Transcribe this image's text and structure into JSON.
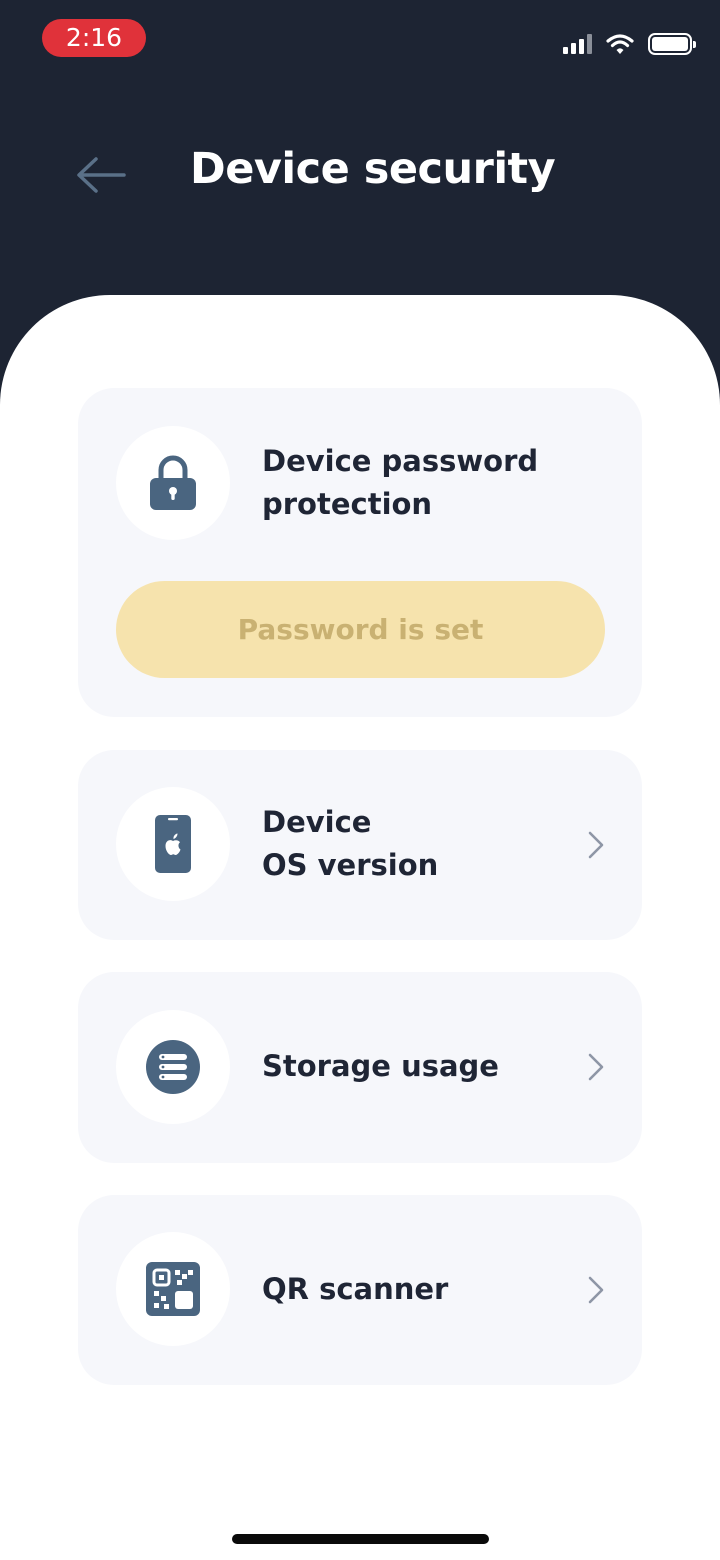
{
  "status_bar": {
    "time": "2:16",
    "icons": [
      "signal-icon",
      "wifi-icon",
      "battery-icon"
    ]
  },
  "header": {
    "back_icon": "arrow-left-icon",
    "title": "Device security"
  },
  "cards": {
    "password": {
      "icon": "lock-icon",
      "label_line1": "Device password",
      "label_line2": "protection",
      "status": "Password is set"
    },
    "os_version": {
      "icon": "phone-apple-icon",
      "label_line1": "Device",
      "label_line2": "OS version"
    },
    "storage": {
      "icon": "storage-icon",
      "label": "Storage usage"
    },
    "qr": {
      "icon": "qr-code-icon",
      "label": "QR scanner"
    }
  },
  "colors": {
    "header_bg": "#1d2433",
    "card_bg": "#f6f7fb",
    "icon_fill": "#4a6580",
    "status_pill_bg": "#f6e3ad",
    "status_pill_text": "#c9b172",
    "time_pill": "#e0323a"
  }
}
